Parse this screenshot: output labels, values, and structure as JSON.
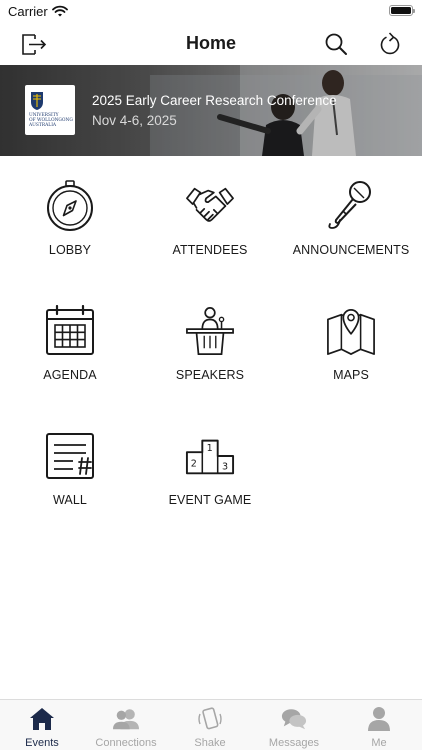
{
  "status": {
    "carrier": "Carrier"
  },
  "nav": {
    "title": "Home",
    "left_icon": "logout-icon",
    "right_icons": [
      "search-icon",
      "refresh-icon"
    ]
  },
  "banner": {
    "title": "2025 Early Career Research Conference",
    "date": "Nov 4-6, 2025",
    "logo_text": [
      "UNIVERSITY",
      "OF WOLLONGONG",
      "AUSTRALIA"
    ]
  },
  "tiles": [
    {
      "label": "LOBBY",
      "icon": "compass-icon"
    },
    {
      "label": "ATTENDEES",
      "icon": "handshake-icon"
    },
    {
      "label": "ANNOUNCEMENTS",
      "icon": "microphone-icon"
    },
    {
      "label": "AGENDA",
      "icon": "calendar-icon"
    },
    {
      "label": "SPEAKERS",
      "icon": "podium-icon"
    },
    {
      "label": "MAPS",
      "icon": "map-icon"
    },
    {
      "label": "WALL",
      "icon": "wall-post-icon"
    },
    {
      "label": "EVENT GAME",
      "icon": "winners-podium-icon"
    }
  ],
  "tab_bar": {
    "active": "Events",
    "colors": {
      "active": "#1c2a4a",
      "inactive": "#a6a6a6"
    },
    "tabs": [
      {
        "label": "Events",
        "icon": "house-icon"
      },
      {
        "label": "Connections",
        "icon": "people-icon"
      },
      {
        "label": "Shake",
        "icon": "shake-phone-icon"
      },
      {
        "label": "Messages",
        "icon": "chat-bubbles-icon"
      },
      {
        "label": "Me",
        "icon": "person-icon"
      }
    ]
  }
}
